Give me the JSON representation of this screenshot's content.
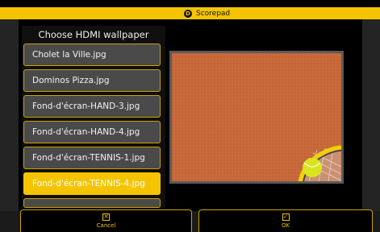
{
  "app": {
    "title": "Scorepad",
    "logo_glyph": "D"
  },
  "dialog": {
    "title": "Choose HDMI wallpaper",
    "files": [
      {
        "label": "Cholet la Ville.jpg",
        "selected": false
      },
      {
        "label": "Dominos Pizza.jpg",
        "selected": false
      },
      {
        "label": "Fond-d'écran-HAND-3.jpg",
        "selected": false
      },
      {
        "label": "Fond-d'écran-HAND-4.jpg",
        "selected": false
      },
      {
        "label": "Fond-d'écran-TENNIS-1.jpg",
        "selected": false
      },
      {
        "label": "Fond-d'écran-TENNIS-4.jpg",
        "selected": true
      }
    ],
    "preview_icon": "tennis-clay-court-wallpaper",
    "cancel_label": "Cancel",
    "ok_label": "OK"
  },
  "colors": {
    "accent": "#f5c400",
    "item_bg": "#4a4a4a",
    "clay": "#c8693a"
  }
}
